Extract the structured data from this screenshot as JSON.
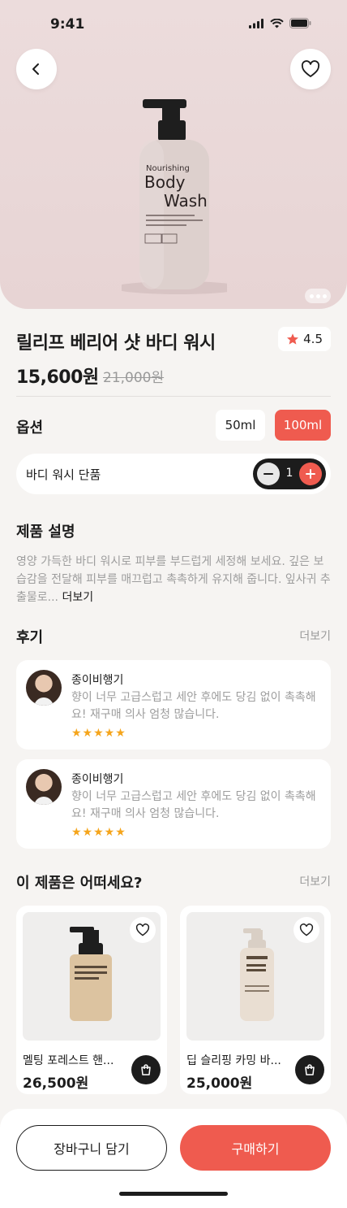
{
  "status": {
    "time": "9:41"
  },
  "product": {
    "title": "릴리프 베리어 샷 바디 워시",
    "rating": "4.5",
    "price": "15,600원",
    "old_price": "21,000원",
    "image_label": {
      "line1": "Nourishing",
      "line2": "Body",
      "line3": "Wash"
    }
  },
  "options": {
    "title": "옵션",
    "sizes": [
      "50ml",
      "100ml"
    ],
    "selected": "100ml",
    "item_label": "바디 워시 단품",
    "quantity": "1"
  },
  "description": {
    "title": "제품 설명",
    "text": "영양 가득한 바디 워시로 피부를 부드럽게 세정해 보세요. 깊은 보습감을 전달해 피부를 매끄럽고 촉촉하게 유지해 줍니다. 잎사귀 추출물로... ",
    "more": "더보기"
  },
  "reviews": {
    "title": "후기",
    "more": "더보기",
    "items": [
      {
        "name": "종이비행기",
        "text": "향이 너무 고급스럽고 세안 후에도 당김 없이 촉촉해요! 재구매 의사 엄청 많습니다.",
        "stars": "★★★★★"
      },
      {
        "name": "종이비행기",
        "text": "향이 너무 고급스럽고 세안 후에도 당김 없이 촉촉해요! 재구매 의사 엄청 많습니다.",
        "stars": "★★★★★"
      }
    ]
  },
  "recommend": {
    "title": "이 제품은 어떠세요?",
    "more": "더보기",
    "items": [
      {
        "name": "멜팅 포레스트 핸...",
        "price": "26,500원"
      },
      {
        "name": "딥 슬리핑 카밍 바...",
        "price": "25,000원"
      }
    ]
  },
  "actions": {
    "cart": "장바구니 담기",
    "buy": "구매하기"
  },
  "colors": {
    "accent": "#ef5b4f",
    "dark": "#1c1c1c",
    "hero_bg": "#ecdcdc",
    "star": "#f5a51c"
  }
}
